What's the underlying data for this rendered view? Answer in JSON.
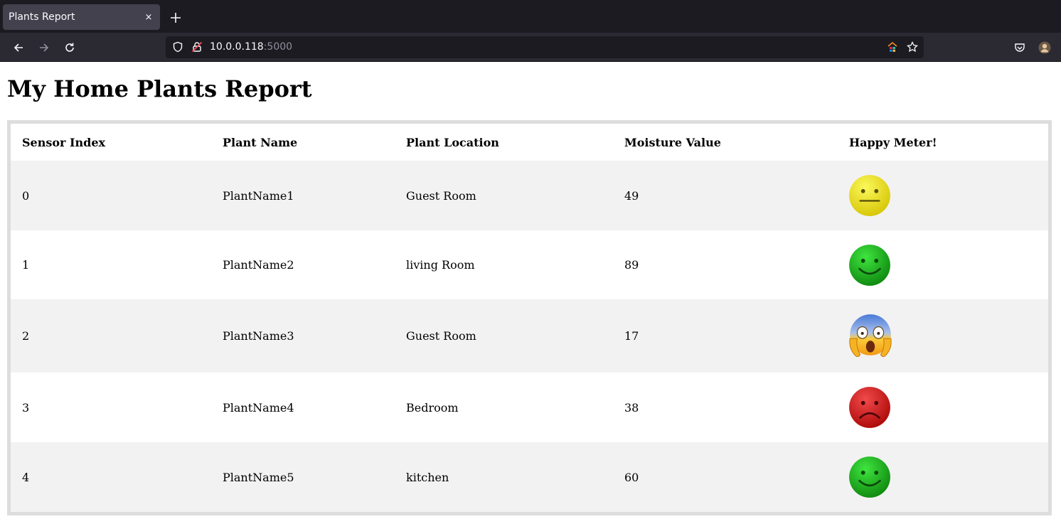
{
  "browser": {
    "tab_title": "Plants Report",
    "tab_close": "×",
    "url_host": "10.0.0.118",
    "url_port": ":5000"
  },
  "page": {
    "title": "My Home Plants Report"
  },
  "table": {
    "headers": [
      "Sensor Index",
      "Plant Name",
      "Plant Location",
      "Moisture Value",
      "Happy Meter!"
    ],
    "rows": [
      {
        "index": "0",
        "name": "PlantName1",
        "location": "Guest Room",
        "moisture": "49",
        "mood": "neutral-face-icon",
        "mood_color": "#e6e014"
      },
      {
        "index": "1",
        "name": "PlantName2",
        "location": "living Room",
        "moisture": "89",
        "mood": "happy-face-icon",
        "mood_color": "#1fb61f"
      },
      {
        "index": "2",
        "name": "PlantName3",
        "location": "Guest Room",
        "moisture": "17",
        "mood": "screaming-face-icon",
        "mood_color": "#f5b324"
      },
      {
        "index": "3",
        "name": "PlantName4",
        "location": "Bedroom",
        "moisture": "38",
        "mood": "sad-face-icon",
        "mood_color": "#d81a1a"
      },
      {
        "index": "4",
        "name": "PlantName5",
        "location": "kitchen",
        "moisture": "60",
        "mood": "happy-face-icon",
        "mood_color": "#1fb61f"
      }
    ]
  }
}
